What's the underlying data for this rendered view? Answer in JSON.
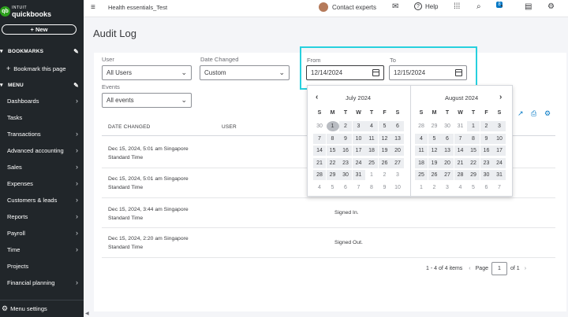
{
  "sidebar": {
    "logo_top": "INTUIT",
    "logo_main": "quickbooks",
    "new_label": "+ New",
    "bookmarks_label": "BOOKMARKS",
    "bookmark_page_label": "Bookmark this page",
    "menu_label": "MENU",
    "items": [
      {
        "label": "Dashboards",
        "chevron": true
      },
      {
        "label": "Tasks",
        "chevron": false
      },
      {
        "label": "Transactions",
        "chevron": true
      },
      {
        "label": "Advanced accounting",
        "chevron": true
      },
      {
        "label": "Sales",
        "chevron": true
      },
      {
        "label": "Expenses",
        "chevron": true
      },
      {
        "label": "Customers & leads",
        "chevron": true
      },
      {
        "label": "Reports",
        "chevron": true
      },
      {
        "label": "Payroll",
        "chevron": true
      },
      {
        "label": "Time",
        "chevron": true
      },
      {
        "label": "Projects",
        "chevron": false
      },
      {
        "label": "Financial planning",
        "chevron": true
      }
    ],
    "menu_settings_label": "Menu settings"
  },
  "topbar": {
    "company_name": "Health essentials_Test",
    "contact_label": "Contact experts",
    "help_label": "Help",
    "notification_count": "8"
  },
  "page": {
    "title": "Audit Log"
  },
  "filters": {
    "user_label": "User",
    "user_value": "All Users",
    "date_changed_label": "Date Changed",
    "date_changed_value": "Custom",
    "from_label": "From",
    "from_value": "12/14/2024",
    "to_label": "To",
    "to_value": "12/15/2024",
    "events_label": "Events",
    "events_value": "All events"
  },
  "table": {
    "columns": [
      "DATE CHANGED",
      "USER"
    ],
    "rows": [
      {
        "date_line1": "Dec 15, 2024, 5:01 am Singapore",
        "date_line2": "Standard Time",
        "event": ""
      },
      {
        "date_line1": "Dec 15, 2024, 5:01 am Singapore",
        "date_line2": "Standard Time",
        "event": ""
      },
      {
        "date_line1": "Dec 15, 2024, 3:44 am Singapore",
        "date_line2": "Standard Time",
        "event": "Signed In."
      },
      {
        "date_line1": "Dec 15, 2024, 2:20 am Singapore",
        "date_line2": "Standard Time",
        "event": "Signed Out."
      }
    ]
  },
  "pagination": {
    "summary": "1 - 4 of 4 items",
    "page_label": "Page",
    "page_value": "1",
    "of_label": "of 1"
  },
  "calendar": {
    "weekdays": [
      "S",
      "M",
      "T",
      "W",
      "T",
      "F",
      "S"
    ],
    "left_month": "July 2024",
    "right_month": "August 2024",
    "left_days": [
      [
        "30",
        "1",
        "2",
        "3",
        "4",
        "5",
        "6"
      ],
      [
        "7",
        "8",
        "9",
        "10",
        "11",
        "12",
        "13"
      ],
      [
        "14",
        "15",
        "16",
        "17",
        "18",
        "19",
        "20"
      ],
      [
        "21",
        "22",
        "23",
        "24",
        "25",
        "26",
        "27"
      ],
      [
        "28",
        "29",
        "30",
        "31",
        "1",
        "2",
        "3"
      ],
      [
        "4",
        "5",
        "6",
        "7",
        "8",
        "9",
        "10"
      ]
    ],
    "right_days": [
      [
        "28",
        "29",
        "30",
        "31",
        "1",
        "2",
        "3"
      ],
      [
        "4",
        "5",
        "6",
        "7",
        "8",
        "9",
        "10"
      ],
      [
        "11",
        "12",
        "13",
        "14",
        "15",
        "16",
        "17"
      ],
      [
        "18",
        "19",
        "20",
        "21",
        "22",
        "23",
        "24"
      ],
      [
        "25",
        "26",
        "27",
        "28",
        "29",
        "30",
        "31"
      ],
      [
        "1",
        "2",
        "3",
        "4",
        "5",
        "6",
        "7"
      ]
    ],
    "left_today": "1",
    "colors": {
      "highlight_border": "#27d0de",
      "today_bg": "#b9bcc2",
      "in_month_bg": "#eceef1"
    }
  }
}
